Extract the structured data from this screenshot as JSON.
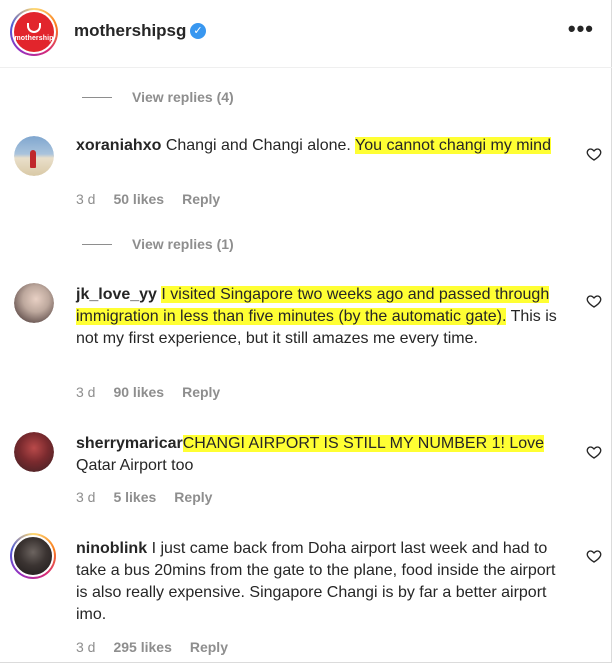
{
  "header": {
    "logo_text": "mothership",
    "username": "mothershipsg",
    "verified_icon": "check",
    "more_icon": "•••"
  },
  "colors": {
    "highlight": "#ffff33",
    "muted": "#8e8e8e",
    "text": "#262626",
    "verified": "#3897f0"
  },
  "view_replies": [
    {
      "label": "View replies (4)"
    },
    {
      "label": "View replies (1)"
    }
  ],
  "comments": [
    {
      "user": "xoraniahxo",
      "text_plain": "Changi and Changi alone.",
      "text_highlight": "You cannot changi my mind",
      "text_after": "",
      "time": "3 d",
      "likes": "50 likes",
      "reply": "Reply",
      "avatar_ring": false
    },
    {
      "user": "jk_love_yy",
      "text_plain": "",
      "text_highlight": "I visited Singapore two weeks ago and passed through immigration in less than five minutes (by the automatic gate).",
      "text_after": "This is not my first experience, but it still amazes me every time.",
      "time": "3 d",
      "likes": "90 likes",
      "reply": "Reply",
      "avatar_ring": false
    },
    {
      "user": "sherrymaricar",
      "text_plain": "",
      "text_highlight": "CHANGI AIRPORT IS STILL MY NUMBER 1! Love",
      "text_after": "Qatar Airport too",
      "time": "3 d",
      "likes": "5 likes",
      "reply": "Reply",
      "avatar_ring": false
    },
    {
      "user": "ninoblink",
      "text_plain": "I just came back from Doha airport last week and had to take a bus 20mins from the gate to the plane, food inside the airport is also really expensive. Singapore Changi is by far a better airport imo.",
      "text_highlight": "",
      "text_after": "",
      "time": "3 d",
      "likes": "295 likes",
      "reply": "Reply",
      "avatar_ring": true
    }
  ]
}
